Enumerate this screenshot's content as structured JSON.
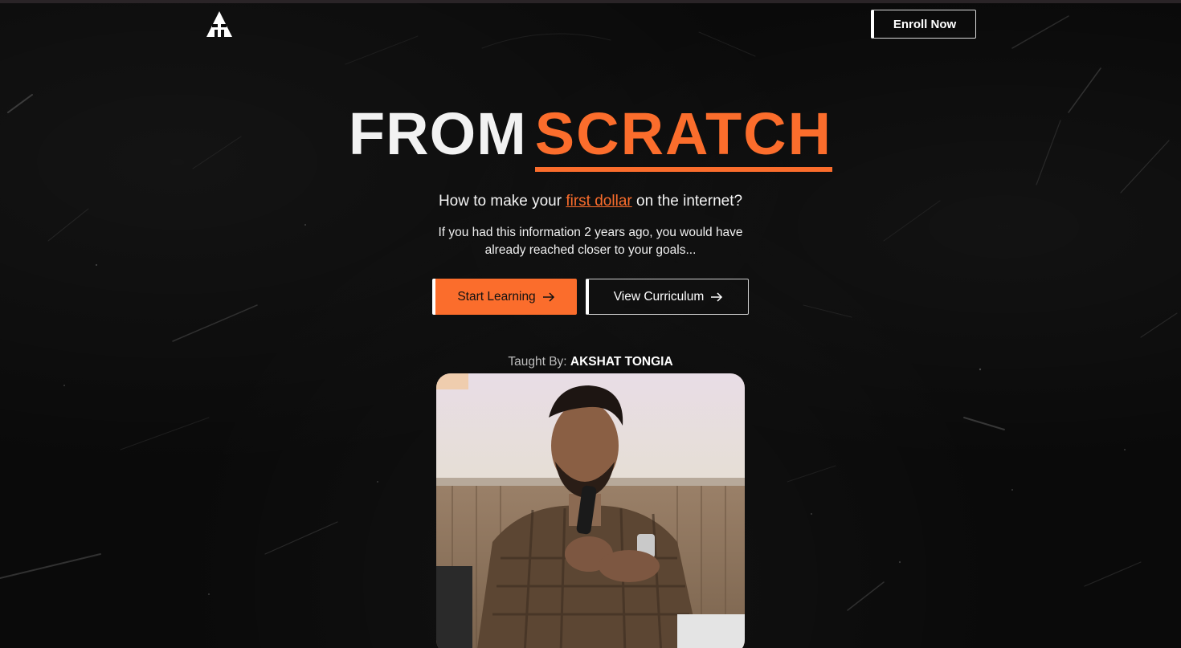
{
  "header": {
    "logo_icon": "a-triangle-logo-icon",
    "enroll_label": "Enroll Now"
  },
  "hero": {
    "title_word1": "FROM",
    "title_word2": "SCRATCH",
    "subtitle_before": "How to make your ",
    "subtitle_highlight": "first dollar",
    "subtitle_after": " on the internet?",
    "description_line1": "If you had this information 2 years ago, you would have",
    "description_line2": "already reached closer to your goals..."
  },
  "cta": {
    "start_label": "Start Learning",
    "view_label": "View Curriculum",
    "arrow_icon": "arrow-right-icon"
  },
  "instructor": {
    "taught_label": "Taught By: ",
    "name": "AKSHAT TONGIA"
  },
  "colors": {
    "accent": "#fb6d2c",
    "background": "#0a0a0a",
    "text": "#ffffff"
  }
}
